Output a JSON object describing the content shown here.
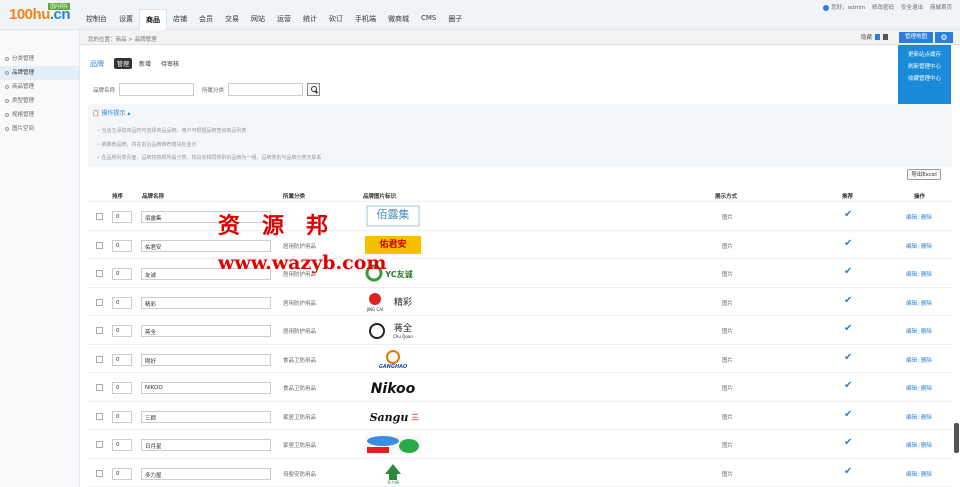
{
  "logo": {
    "main": "100hu",
    "suffix": ".cn",
    "badge": "国内领先"
  },
  "nav": [
    "控制台",
    "设置",
    "商品",
    "店铺",
    "会员",
    "交易",
    "网站",
    "运营",
    "统计",
    "砍订",
    "手机端",
    "微商城",
    "CMS",
    "圈子"
  ],
  "nav_active": "商品",
  "userbar": {
    "greeting": "您好，admin",
    "change_password": "修改密码",
    "logout": "安全退出",
    "home": "商城首页"
  },
  "sidebar": [
    {
      "label": "分类管理",
      "active": false
    },
    {
      "label": "品牌管理",
      "active": true
    },
    {
      "label": "商品管理",
      "active": false
    },
    {
      "label": "类型管理",
      "active": false
    },
    {
      "label": "规格管理",
      "active": false
    },
    {
      "label": "图片空间",
      "active": false
    }
  ],
  "breadcrumb": "您的位置：商品 > 品牌管理",
  "crumb_tools": {
    "label": "隐藏"
  },
  "manage_button": "管理地图",
  "dropdown_items": [
    "更新站点缓存",
    "刷新管理中心",
    "收藏管理中心"
  ],
  "page": {
    "title": "品牌",
    "tabs": [
      "管理",
      "新增",
      "待审核"
    ],
    "active_tab": "管理"
  },
  "filter": {
    "brand_name_label": "品牌名称",
    "category_label": "所属分类"
  },
  "tips": {
    "title": "操作提示",
    "items": [
      "当店主添加商品时可选择商品品牌，用户可根据品牌查询商品列表",
      "被推荐品牌，将在前台品牌推荐模块处显示",
      "在品牌列表页面，品牌将按照所属分类，将具有相同类别的品牌为一组，品牌类别与品牌分类无联系"
    ]
  },
  "export_label": "导出Excel",
  "columns": {
    "sort": "排序",
    "name": "品牌名称",
    "category": "所属分类",
    "logo": "品牌图片标识",
    "display": "展示方式",
    "recommend": "推荐",
    "ops": "操作"
  },
  "rows": [
    {
      "sort": "0",
      "name": "佰露集",
      "category": "",
      "logo": "佰露集",
      "display": "图片",
      "recommended": true
    },
    {
      "sort": "0",
      "name": "佑君安",
      "category": "居用防护用品",
      "logo": "佑君安",
      "display": "图片",
      "recommended": true
    },
    {
      "sort": "0",
      "name": "友诚",
      "category": "居用防护用品",
      "logo": "YC友诚",
      "display": "图片",
      "recommended": true
    },
    {
      "sort": "0",
      "name": "精彩",
      "category": "居用防护用品",
      "logo": "精彩",
      "display": "图片",
      "recommended": true
    },
    {
      "sort": "0",
      "name": "蒋全",
      "category": "居用防护用品",
      "logo": "蒋全",
      "display": "图片",
      "recommended": true
    },
    {
      "sort": "0",
      "name": "刚好",
      "category": "食品卫防用品",
      "logo": "GANGHAO",
      "display": "图片",
      "recommended": true
    },
    {
      "sort": "0",
      "name": "NIKOO",
      "category": "食品卫防用品",
      "logo": "Nikoo",
      "display": "图片",
      "recommended": true
    },
    {
      "sort": "0",
      "name": "三顾",
      "category": "家居卫防用品",
      "logo": "Sangu",
      "display": "图片",
      "recommended": true
    },
    {
      "sort": "0",
      "name": "日月星",
      "category": "家居卫防用品",
      "logo": "日月星",
      "display": "图片",
      "recommended": true
    },
    {
      "sort": "0",
      "name": "多力屋",
      "category": "母婴安防用品",
      "logo": "多力屋",
      "display": "图片",
      "recommended": true
    }
  ],
  "op_labels": {
    "edit": "编辑",
    "delete": "删除"
  },
  "watermark": {
    "line1": "资源邦",
    "line2": "www.wazyb.com"
  }
}
